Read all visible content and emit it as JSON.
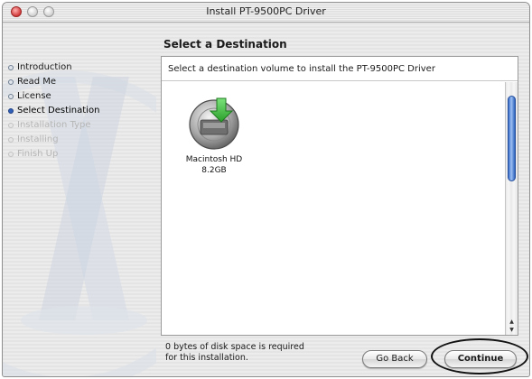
{
  "window": {
    "title": "Install PT-9500PC Driver"
  },
  "sidebar": {
    "steps": [
      {
        "label": "Introduction",
        "state": "done"
      },
      {
        "label": "Read Me",
        "state": "done"
      },
      {
        "label": "License",
        "state": "done"
      },
      {
        "label": "Select Destination",
        "state": "current"
      },
      {
        "label": "Installation Type",
        "state": "future"
      },
      {
        "label": "Installing",
        "state": "future"
      },
      {
        "label": "Finish Up",
        "state": "future"
      }
    ]
  },
  "main": {
    "heading": "Select a Destination",
    "instruction": "Select a destination volume to install the PT-9500PC Driver",
    "volume": {
      "name": "Macintosh HD",
      "size": "8.2GB",
      "icon": "hard-drive-icon"
    },
    "disk_info": {
      "line1": "0 bytes of disk space is required",
      "line2": "for this installation."
    }
  },
  "buttons": {
    "go_back": "Go Back",
    "continue": "Continue"
  },
  "colors": {
    "accent": "#2f63be",
    "current_bullet": "#2f5fb8",
    "install_arrow": "#3cc23c"
  }
}
